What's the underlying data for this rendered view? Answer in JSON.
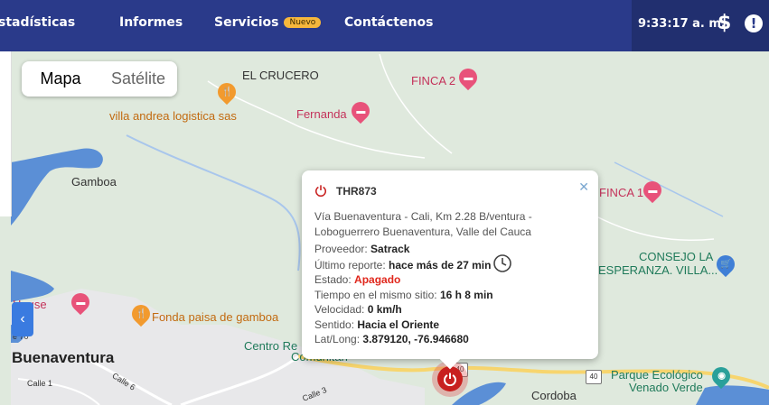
{
  "nav": {
    "items": [
      {
        "label": "stadísticas"
      },
      {
        "label": "Informes"
      },
      {
        "label": "Servicios",
        "badge": "Nuevo"
      },
      {
        "label": "Contáctenos"
      }
    ],
    "time": "9:33:17 a. m.",
    "dollar_icon": "$",
    "alert_icon": "!"
  },
  "map": {
    "type_control": {
      "map": "Mapa",
      "satellite": "Satélite"
    },
    "labels": {
      "el_crucero": "EL CRUCERO",
      "finca2": "FINCA 2",
      "villa_andrea": "villa andrea logistica sas",
      "fernanda": "Fernanda",
      "gamboa": "Gamboa",
      "finca1": "FINCA 1",
      "consejo_l1": "CONSEJO LA",
      "consejo_l2": "ESPERANZA. VILLA...",
      "house": "House",
      "fonda": "Fonda paisa de gamboa",
      "centro": "Centro Re",
      "comunitari": "Comunitari",
      "buenaventura": "Buenaventura",
      "parque_l1": "Parque Ecológico",
      "parque_l2": "Venado Verde",
      "cordoba": "Cordoba",
      "calle1": "Calle 1",
      "calle6": "Calle 6",
      "calle3": "Calle 3",
      "route40": "40",
      "route40b": "40",
      "route70": "e 70"
    }
  },
  "popup": {
    "vehicle": "THR873",
    "address_line1": "Vía Buenaventura - Cali, Km 2.28 B/ventura -",
    "address_line2": "Loboguerrero Buenaventura, Valle del Cauca",
    "provider_label": "Proveedor:",
    "provider": "Satrack",
    "last_report_label": "Último reporte:",
    "last_report": "hace más de 27 min",
    "status_label": "Estado:",
    "status": "Apagado",
    "time_same_label": "Tiempo en el mismo sitio:",
    "time_same": "16 h 8 min",
    "speed_label": "Velocidad:",
    "speed": "0 km/h",
    "direction_label": "Sentido:",
    "direction": "Hacia el Oriente",
    "latlong_label": "Lat/Long:",
    "latlong": "3.879120, -76.946680"
  },
  "colors": {
    "nav": "#2a3a8a",
    "status_off": "#e0271c",
    "water": "#5b8fd6",
    "land": "#dfe9dd"
  }
}
